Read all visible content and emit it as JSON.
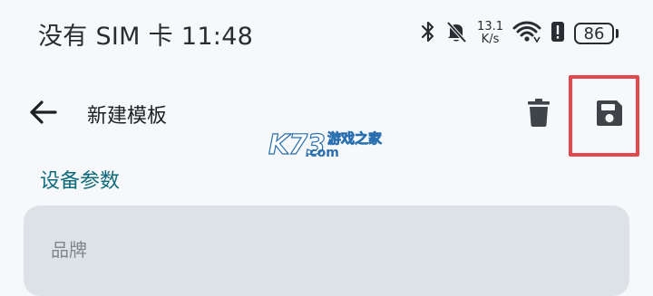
{
  "status_bar": {
    "carrier_time": "没有 SIM 卡 11:48",
    "net_speed_value": "13.1",
    "net_speed_unit": "K/s",
    "battery_level": "86",
    "icons": [
      "bluetooth-icon",
      "mute-bell-icon",
      "wifi-icon",
      "battery-alert-icon",
      "battery-icon"
    ]
  },
  "app_bar": {
    "title": "新建模板",
    "icons": [
      "back-arrow-icon",
      "delete-icon",
      "save-icon"
    ],
    "highlight_color": "#e5484d"
  },
  "watermark": {
    "brand": "K73",
    "site": "游戏之家",
    "domain": ".com"
  },
  "form": {
    "section_title": "设备参数",
    "fields": [
      {
        "placeholder": "品牌",
        "value": ""
      }
    ],
    "accent_color": "#0f6a7a"
  }
}
